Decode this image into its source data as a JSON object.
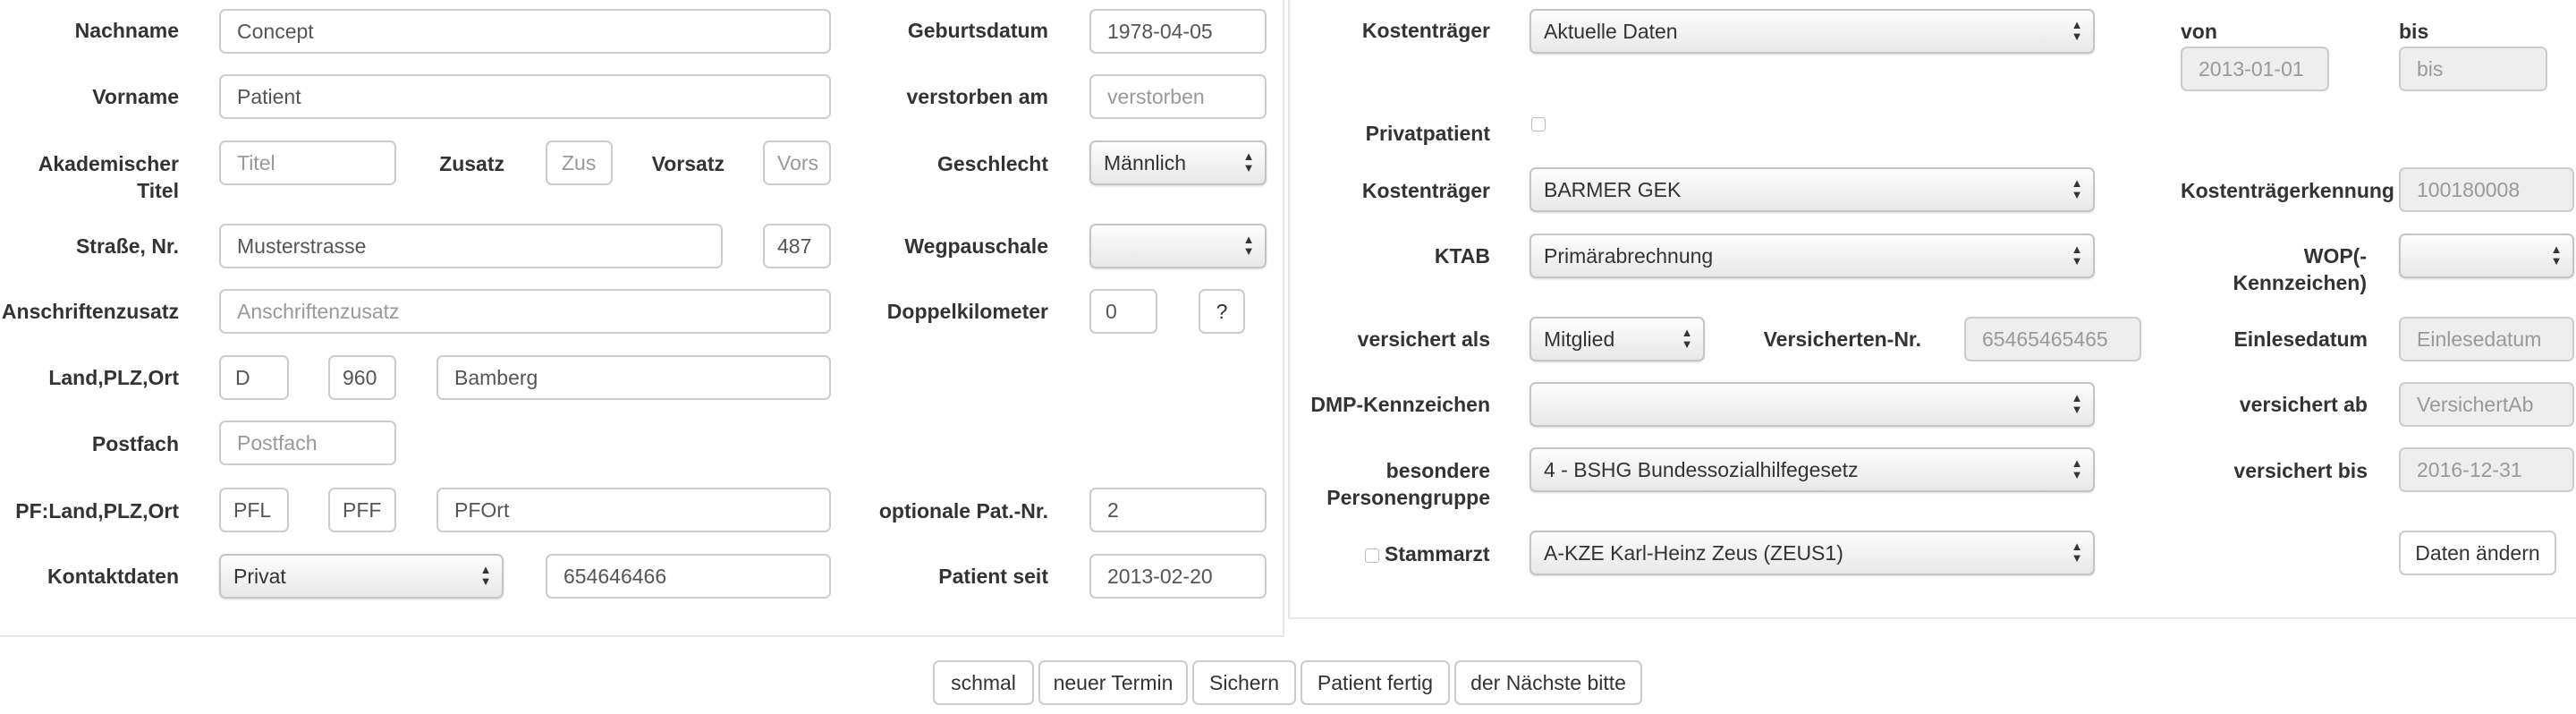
{
  "patient": {
    "nachname": {
      "label": "Nachname",
      "value": "Concept"
    },
    "vorname": {
      "label": "Vorname",
      "value": "Patient"
    },
    "akademischer_titel": {
      "label": "Akademischer Titel",
      "placeholder": "Titel"
    },
    "zusatz": {
      "label": "Zusatz",
      "placeholder": "Zus"
    },
    "vorsatz": {
      "label": "Vorsatz",
      "placeholder": "Vors"
    },
    "strasse": {
      "label": "Straße, Nr.",
      "value": "Musterstrasse",
      "nr": "487"
    },
    "anschriftenzusatz": {
      "label": "Anschriftenzusatz",
      "placeholder": "Anschriftenzusatz"
    },
    "land_plz_ort": {
      "label": "Land,PLZ,Ort",
      "land": "D",
      "plz": "960",
      "ort": "Bamberg"
    },
    "postfach": {
      "label": "Postfach",
      "placeholder": "Postfach"
    },
    "pf_land_plz_ort": {
      "label": "PF:Land,PLZ,Ort",
      "land": "PFL",
      "plz": "PFF",
      "ort": "PFOrt"
    },
    "kontaktdaten": {
      "label": "Kontaktdaten",
      "type": "Privat",
      "value": "654646466"
    },
    "geburtsdatum": {
      "label": "Geburtsdatum",
      "value": "1978-04-05"
    },
    "verstorben_am": {
      "label": "verstorben am",
      "placeholder": "verstorben"
    },
    "geschlecht": {
      "label": "Geschlecht",
      "value": "Männlich"
    },
    "wegpauschale": {
      "label": "Wegpauschale",
      "value": ""
    },
    "doppelkilometer": {
      "label": "Doppelkilometer",
      "value": "0",
      "help": "?"
    },
    "optionale_pat_nr": {
      "label": "optionale Pat.-Nr.",
      "value": "2"
    },
    "patient_seit": {
      "label": "Patient seit",
      "value": "2013-02-20"
    }
  },
  "insurance": {
    "kostentraeger_top": {
      "label": "Kostenträger",
      "value": "Aktuelle Daten"
    },
    "von": {
      "label": "von",
      "value": "2013-01-01"
    },
    "bis": {
      "label": "bis",
      "placeholder": "bis"
    },
    "privatpatient": {
      "label": "Privatpatient",
      "checked": false
    },
    "kostentraeger": {
      "label": "Kostenträger",
      "value": "BARMER GEK"
    },
    "kostentraegerkennung": {
      "label": "Kostenträgerkennung",
      "value": "100180008"
    },
    "ktab": {
      "label": "KTAB",
      "value": "Primärabrechnung"
    },
    "wop": {
      "label": "WOP(-Kennzeichen)",
      "value": ""
    },
    "versichert_als": {
      "label": "versichert als",
      "value": "Mitglied"
    },
    "versicherten_nr": {
      "label": "Versicherten-Nr.",
      "value": "65465465465"
    },
    "einlesedatum": {
      "label": "Einlesedatum",
      "placeholder": "Einlesedatum"
    },
    "dmp": {
      "label": "DMP-Kennzeichen",
      "value": ""
    },
    "versichert_ab": {
      "label": "versichert ab",
      "placeholder": "VersichertAb"
    },
    "personengruppe": {
      "label": "besondere Personengruppe",
      "value": "4 - BSHG Bundessozialhilfegesetz"
    },
    "versichert_bis": {
      "label": "versichert bis",
      "value": "2016-12-31"
    },
    "stammarzt": {
      "label": "Stammarzt",
      "value": "A-KZE Karl-Heinz Zeus (ZEUS1)",
      "checked": false
    },
    "daten_aendern": "Daten ändern"
  },
  "footer": {
    "schmal": "schmal",
    "neuer_termin": "neuer Termin",
    "sichern": "Sichern",
    "patient_fertig": "Patient fertig",
    "naechste": "der Nächste bitte"
  }
}
